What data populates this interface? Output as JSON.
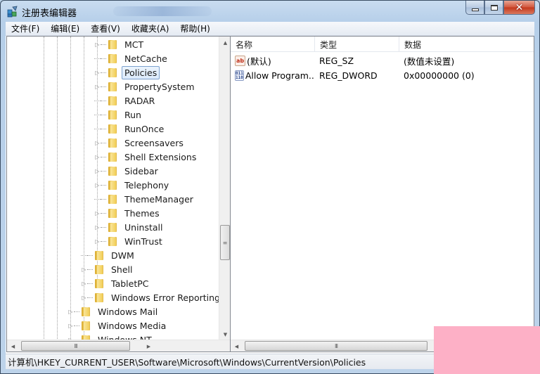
{
  "window": {
    "title": "注册表编辑器",
    "controls": {
      "minimize": "minimize",
      "maximize": "maximize",
      "close": "✕"
    }
  },
  "menu": {
    "items": [
      "文件(F)",
      "编辑(E)",
      "查看(V)",
      "收藏夹(A)",
      "帮助(H)"
    ]
  },
  "tree": {
    "items": [
      {
        "label": "MCT",
        "level": 6,
        "expandable": true,
        "selected": false
      },
      {
        "label": "NetCache",
        "level": 6,
        "expandable": false,
        "selected": false
      },
      {
        "label": "Policies",
        "level": 6,
        "expandable": true,
        "selected": true
      },
      {
        "label": "PropertySystem",
        "level": 6,
        "expandable": true,
        "selected": false
      },
      {
        "label": "RADAR",
        "level": 6,
        "expandable": false,
        "selected": false
      },
      {
        "label": "Run",
        "level": 6,
        "expandable": false,
        "selected": false
      },
      {
        "label": "RunOnce",
        "level": 6,
        "expandable": false,
        "selected": false
      },
      {
        "label": "Screensavers",
        "level": 6,
        "expandable": true,
        "selected": false
      },
      {
        "label": "Shell Extensions",
        "level": 6,
        "expandable": true,
        "selected": false
      },
      {
        "label": "Sidebar",
        "level": 6,
        "expandable": true,
        "selected": false
      },
      {
        "label": "Telephony",
        "level": 6,
        "expandable": true,
        "selected": false
      },
      {
        "label": "ThemeManager",
        "level": 6,
        "expandable": false,
        "selected": false
      },
      {
        "label": "Themes",
        "level": 6,
        "expandable": true,
        "selected": false
      },
      {
        "label": "Uninstall",
        "level": 6,
        "expandable": true,
        "selected": false
      },
      {
        "label": "WinTrust",
        "level": 6,
        "expandable": true,
        "selected": false
      },
      {
        "label": "DWM",
        "level": 5,
        "expandable": false,
        "selected": false
      },
      {
        "label": "Shell",
        "level": 5,
        "expandable": true,
        "selected": false
      },
      {
        "label": "TabletPC",
        "level": 5,
        "expandable": true,
        "selected": false
      },
      {
        "label": "Windows Error Reporting",
        "level": 5,
        "expandable": true,
        "selected": false
      },
      {
        "label": "Windows Mail",
        "level": 4,
        "expandable": true,
        "selected": false
      },
      {
        "label": "Windows Media",
        "level": 4,
        "expandable": true,
        "selected": false
      },
      {
        "label": "Windows NT",
        "level": 4,
        "expandable": true,
        "selected": false
      }
    ],
    "scroll_thumb_glyph": "≡",
    "hscroll_thumb_glyph": "III"
  },
  "list": {
    "columns": [
      "名称",
      "类型",
      "数据"
    ],
    "rows": [
      {
        "icon": "string-value-icon",
        "icon_text": "ab",
        "name": "(默认)",
        "type": "REG_SZ",
        "data": "(数值未设置)"
      },
      {
        "icon": "binary-value-icon",
        "icon_text": "011",
        "name": "Allow Program...",
        "type": "REG_DWORD",
        "data": "0x00000000 (0)"
      }
    ],
    "hscroll_thumb_glyph": "III"
  },
  "status": {
    "path": "计算机\\HKEY_CURRENT_USER\\Software\\Microsoft\\Windows\\CurrentVersion\\Policies"
  },
  "colors": {
    "overlay": "#fdb0c6",
    "selection_border": "#7da2ce",
    "close_button": "#c4381c"
  }
}
